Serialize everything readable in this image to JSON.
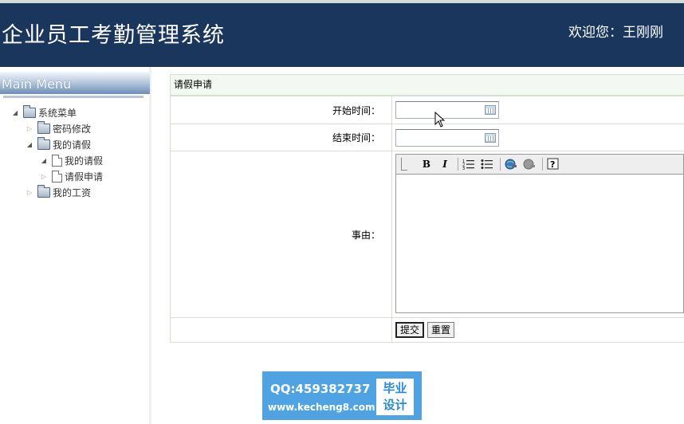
{
  "header": {
    "app_title": "企业员工考勤管理系统",
    "welcome_prefix": "欢迎您：",
    "user_name": "王刚刚"
  },
  "sidebar": {
    "menu_title": "Main Menu",
    "tree": [
      {
        "label": "系统菜单",
        "level": 0,
        "expanded": true,
        "icon": "folder-icon"
      },
      {
        "label": "密码修改",
        "level": 1,
        "expanded": false,
        "icon": "folder-icon"
      },
      {
        "label": "我的请假",
        "level": 1,
        "expanded": true,
        "icon": "folder-icon"
      },
      {
        "label": "我的请假",
        "level": 2,
        "expanded": true,
        "icon": "document-icon"
      },
      {
        "label": "请假申请",
        "level": 2,
        "expanded": false,
        "icon": "document-icon"
      },
      {
        "label": "我的工资",
        "level": 1,
        "expanded": false,
        "icon": "folder-icon"
      }
    ]
  },
  "form": {
    "panel_title": "请假申请",
    "start_label": "开始时间：",
    "start_value": "",
    "end_label": "结束时间：",
    "end_value": "",
    "reason_label": "事由：",
    "reason_value": "",
    "submit_label": "提交",
    "reset_label": "重置"
  },
  "editor_toolbar": [
    "bold-icon",
    "italic-icon",
    "ordered-list-icon",
    "unordered-list-icon",
    "link-icon",
    "unlink-icon",
    "help-icon"
  ],
  "watermark": {
    "qq": "QQ:459382737",
    "url": "www.kecheng8.com",
    "tag_line1": "毕业",
    "tag_line2": "设计"
  },
  "colors": {
    "header_bg": "#1b365d",
    "panel_header_bg": "#f3f8f2",
    "watermark_bg": "#4fa3e3"
  }
}
